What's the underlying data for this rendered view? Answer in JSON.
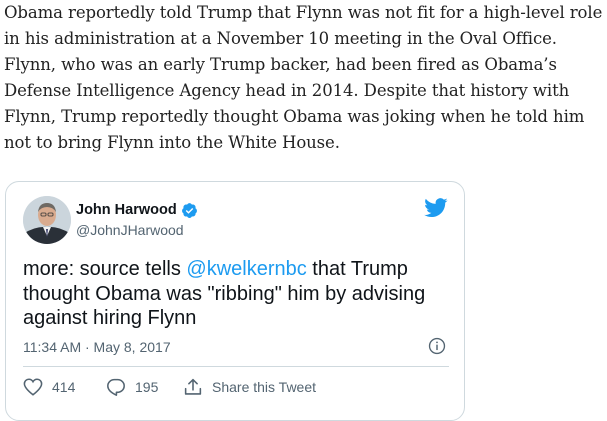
{
  "article": {
    "paragraph": "Obama reportedly told Trump that Flynn was not fit for a high-level role in his administration at a November 10 meeting in the Oval Office. Flynn, who was an early Trump backer, had been fired as Obama’s Defense Intelligence Agency head in 2014. Despite that history with Flynn, Trump reportedly thought Obama was joking when he told him not to bring Flynn into the White House."
  },
  "tweet": {
    "author_name": "John Harwood",
    "author_handle": "@JohnJHarwood",
    "text_before": "more: source tells ",
    "mention": "@kwelkernbc",
    "text_after": " that Trump thought Obama was \"ribbing\" him by advising against hiring Flynn",
    "timestamp": "11:34 AM · May 8, 2017",
    "likes": "414",
    "replies": "195",
    "share_label": "Share this Tweet"
  },
  "icons": {
    "verified": "verified-badge-icon",
    "bird": "twitter-bird-icon",
    "info": "info-icon",
    "like": "heart-icon",
    "reply": "reply-bubble-icon",
    "share": "share-icon"
  },
  "colors": {
    "accent": "#1d9bf0",
    "text": "#0f1419",
    "secondary": "#536471",
    "border": "#cfd9de"
  }
}
